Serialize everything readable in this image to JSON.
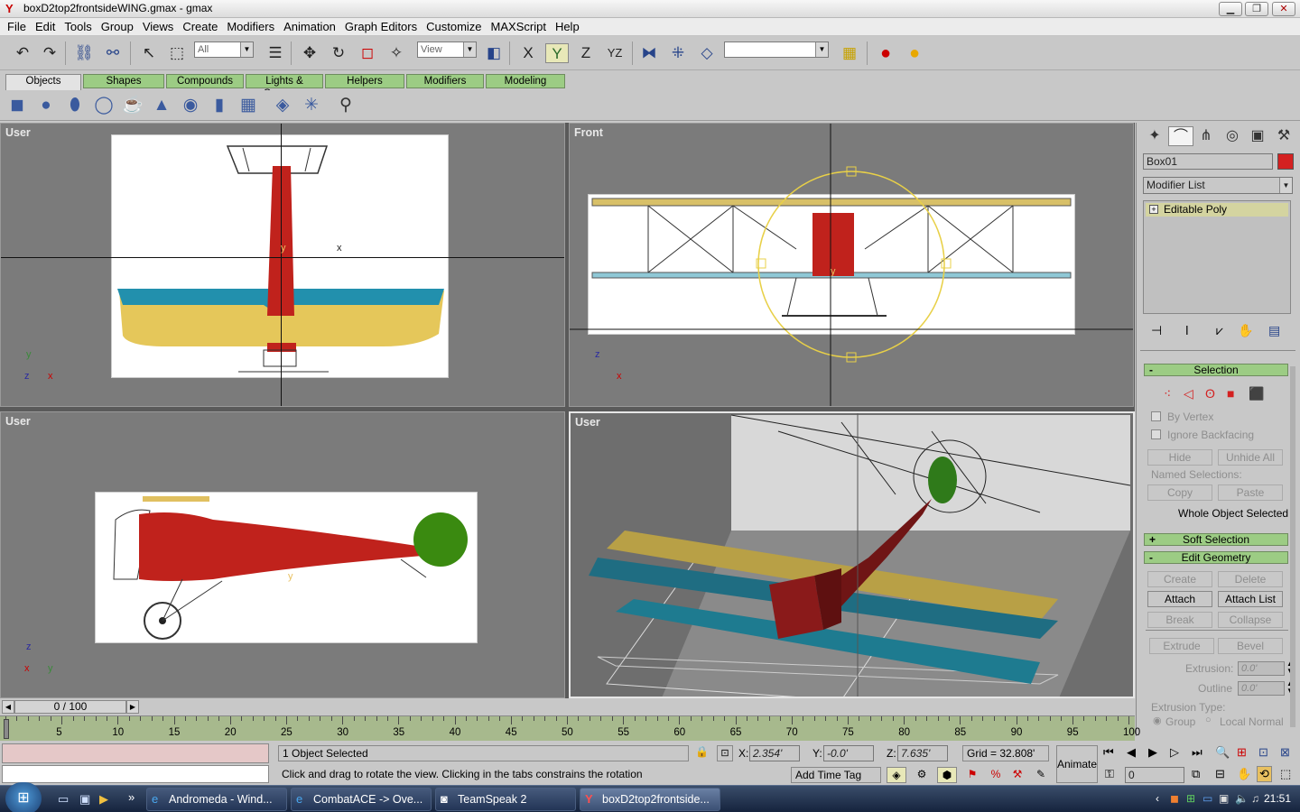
{
  "window": {
    "title": "boxD2top2frontsideWING.gmax - gmax"
  },
  "menubar": [
    "File",
    "Edit",
    "Tools",
    "Group",
    "Views",
    "Create",
    "Modifiers",
    "Animation",
    "Graph Editors",
    "Customize",
    "MAXScript",
    "Help"
  ],
  "toolbar": {
    "selection_filter": "All",
    "ref_coord": "View",
    "named_selection": ""
  },
  "tabs": [
    "Objects",
    "Shapes",
    "Compounds",
    "Lights & Cameras",
    "Helpers",
    "Modifiers",
    "Modeling"
  ],
  "active_tab": "Objects",
  "viewports": [
    {
      "label": "User",
      "active": false
    },
    {
      "label": "Front",
      "active": false
    },
    {
      "label": "User",
      "active": false
    },
    {
      "label": "User",
      "active": true
    }
  ],
  "axis_labels": {
    "x": "x",
    "y": "y",
    "z": "z"
  },
  "command_panel": {
    "object_name": "Box01",
    "object_color": "#d42020",
    "modifier_list": "Modifier List",
    "stack_item": "Editable Poly",
    "selection": {
      "title": "Selection",
      "by_vertex": "By Vertex",
      "ignore_backfacing": "Ignore Backfacing",
      "hide": "Hide",
      "unhide_all": "Unhide All",
      "named_selections": "Named Selections:",
      "copy": "Copy",
      "paste": "Paste",
      "status": "Whole Object Selected"
    },
    "soft_selection": "Soft Selection",
    "edit_geometry": {
      "title": "Edit Geometry",
      "create": "Create",
      "delete": "Delete",
      "attach": "Attach",
      "attach_list": "Attach List",
      "break": "Break",
      "collapse": "Collapse",
      "extrude": "Extrude",
      "bevel": "Bevel",
      "extrusion_label": "Extrusion:",
      "extrusion_value": "0.0'",
      "outline_label": "Outline",
      "outline_value": "0.0'",
      "extrusion_type": "Extrusion Type:",
      "group": "Group",
      "local_normal": "Local Normal"
    }
  },
  "timeline": {
    "position": "0 / 100",
    "ticks": [
      "5",
      "10",
      "15",
      "20",
      "25",
      "30",
      "35",
      "40",
      "45",
      "50",
      "55",
      "60",
      "65",
      "70",
      "75",
      "80",
      "85",
      "90",
      "95",
      "100"
    ]
  },
  "status": {
    "selected": "1 Object Selected",
    "prompt": "Click and drag to rotate the view.  Clicking in the tabs constrains the rotation",
    "x_label": "X:",
    "x": "2.354'",
    "y_label": "Y:",
    "y": "-0.0'",
    "z_label": "Z:",
    "z": "7.635'",
    "grid": "Grid = 32.808'",
    "add_time_tag": "Add Time Tag",
    "animate": "Animate",
    "frame": "0"
  },
  "taskbar": {
    "items": [
      "Andromeda - Wind...",
      "CombatACE -> Ove...",
      "TeamSpeak 2",
      "boxD2top2frontside..."
    ],
    "clock": "21:51"
  }
}
